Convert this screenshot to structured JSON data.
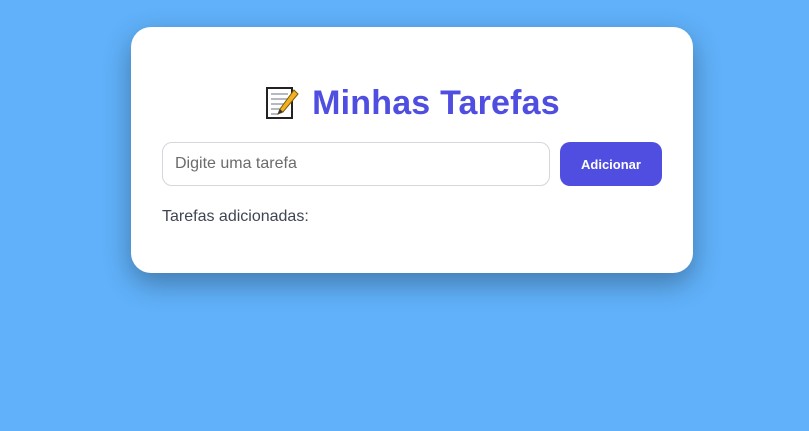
{
  "app": {
    "icon": "memo-icon",
    "title": "Minhas Tarefas"
  },
  "form": {
    "input_placeholder": "Digite uma tarefa",
    "input_value": "",
    "add_button_label": "Adicionar"
  },
  "list": {
    "heading": "Tarefas adicionadas:",
    "items": []
  },
  "colors": {
    "background": "#60b1fa",
    "accent": "#4f4ee0",
    "card": "#ffffff"
  }
}
